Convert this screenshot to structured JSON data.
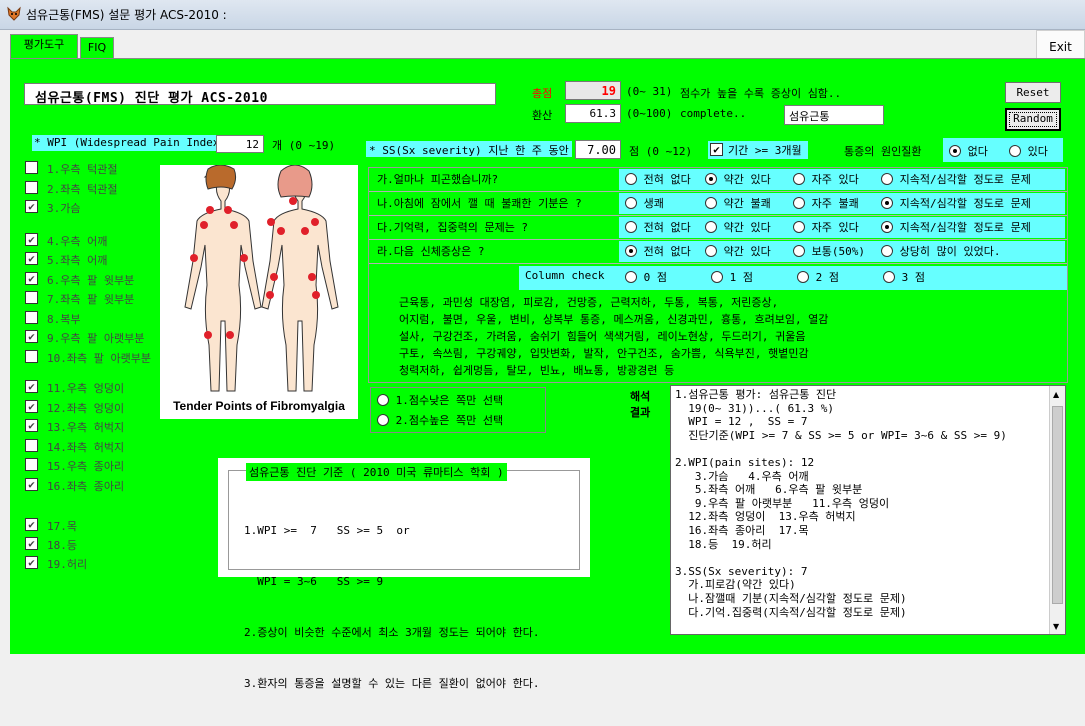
{
  "window": {
    "title": "섬유근통(FMS) 설문 평가 ACS-2010 :",
    "exit_label": "Exit"
  },
  "tabs": [
    {
      "label": "평가도구",
      "active": true
    },
    {
      "label": "FIQ",
      "active": false
    }
  ],
  "header": {
    "banner": "섬유근통(FMS) 진단 평가 ACS-2010",
    "total_label": "총점",
    "total_value": "19",
    "total_range": "(0~ 31)",
    "total_note": "점수가 높을 수록 증상이 심함..",
    "conv_label": "환산",
    "conv_value": "61.3",
    "conv_range": "(0~100)",
    "conv_note": "complete..",
    "diagnosis_value": "섬유근통",
    "reset_label": "Reset",
    "random_label": "Random"
  },
  "wpi": {
    "label": "* WPI (Widespread Pain Index)",
    "value": "12",
    "unit": "개 (0 ~19)"
  },
  "sites": [
    {
      "label": "1.우측 턱관절",
      "checked": false
    },
    {
      "label": "2.좌측 턱관절",
      "checked": false
    },
    {
      "label": "3.가슴",
      "checked": true
    },
    {
      "label": "4.우측 어깨",
      "checked": true
    },
    {
      "label": "5.좌측 어깨",
      "checked": true
    },
    {
      "label": "6.우측 팔 윗부분",
      "checked": true
    },
    {
      "label": "7.좌측 팔 윗부분",
      "checked": false
    },
    {
      "label": "8.복부",
      "checked": false
    },
    {
      "label": "9.우측 팔 아랫부분",
      "checked": true
    },
    {
      "label": "10.좌측 팔 아랫부분",
      "checked": false
    },
    {
      "label": "11.우측 엉덩이",
      "checked": true
    },
    {
      "label": "12.좌측 엉덩이",
      "checked": true
    },
    {
      "label": "13.우측 허벅지",
      "checked": true
    },
    {
      "label": "14.좌측 허벅지",
      "checked": false
    },
    {
      "label": "15.우측 종아리",
      "checked": false
    },
    {
      "label": "16.좌측 종아리",
      "checked": true
    },
    {
      "label": "17.목",
      "checked": true
    },
    {
      "label": "18.등",
      "checked": true
    },
    {
      "label": "19.허리",
      "checked": true
    }
  ],
  "figure": {
    "caption": "Tender Points of Fibromyalgia"
  },
  "ss": {
    "label": "* SS(Sx severity) 지난 한 주 동안",
    "value": "7.00",
    "unit": "점 (0 ~12)",
    "duration_label": "기간 >= 3개월",
    "duration_checked": true,
    "cause_label": "통증의 원인질환",
    "cause_options": [
      {
        "label": "없다",
        "selected": true
      },
      {
        "label": "있다",
        "selected": false
      }
    ]
  },
  "questions": [
    {
      "label": "가.얼마나 피곤했습니까?",
      "options": [
        {
          "label": "전혀 없다",
          "selected": false
        },
        {
          "label": "약간 있다",
          "selected": true
        },
        {
          "label": "자주 있다",
          "selected": false
        },
        {
          "label": "지속적/심각할 정도로 문제",
          "selected": false
        }
      ]
    },
    {
      "label": "나.아침에 잠에서 깰 때 불쾌한 기분은 ?",
      "options": [
        {
          "label": "생쾌",
          "selected": false
        },
        {
          "label": "약간 불쾌",
          "selected": false
        },
        {
          "label": "자주 불쾌",
          "selected": false
        },
        {
          "label": "지속적/심각할 정도로 문제",
          "selected": true
        }
      ]
    },
    {
      "label": "다.기억력, 집중력의 문제는 ?",
      "options": [
        {
          "label": "전혀 없다",
          "selected": false
        },
        {
          "label": "약간 있다",
          "selected": false
        },
        {
          "label": "자주 있다",
          "selected": false
        },
        {
          "label": "지속적/심각할 정도로 문제",
          "selected": true
        }
      ]
    },
    {
      "label": "라.다음 신체증상은 ?",
      "options": [
        {
          "label": "전혀 없다",
          "selected": true
        },
        {
          "label": "약간 있다",
          "selected": false
        },
        {
          "label": "보통(50%)",
          "selected": false
        },
        {
          "label": "상당히 많이 있었다.",
          "selected": false
        }
      ]
    }
  ],
  "column_check": {
    "label": "Column check",
    "options": [
      {
        "label": "0 점",
        "selected": false
      },
      {
        "label": "1 점",
        "selected": false
      },
      {
        "label": "2 점",
        "selected": false
      },
      {
        "label": "3 점",
        "selected": false
      }
    ]
  },
  "symptoms": [
    "근육통, 과민성 대장염, 피로감, 건망증, 근력저하, 두통, 복통, 저린증상,",
    "어지럼, 불면, 우울, 변비, 상복부 통증, 메스꺼움, 신경과민, 흉통, 흐려보임, 열감",
    "설사, 구강건조, 가려움, 숨쉬기 힘들어 색색거림, 레이노현상, 두드러기, 귀울음",
    "구토, 속쓰림, 구강궤양, 입맛변화, 발작, 안구건조, 숨가쁨, 식욕부진, 햇볕민감",
    "청력저하, 쉽게멍듬, 탈모, 빈뇨, 배뇨통, 방광경련 등"
  ],
  "selection": [
    {
      "label": "1.점수낮은 쪽만 선택",
      "selected": false
    },
    {
      "label": "2.점수높은 쪽만 선택",
      "selected": false
    }
  ],
  "criteria": {
    "title": "섬유근통 진단 기준 ( 2010 미국 류마티스 학회 )",
    "lines": [
      "1.WPI >=  7   SS >= 5  or",
      "  WPI = 3~6   SS >= 9",
      "2.증상이 비슷한 수준에서 최소 3개월 정도는 되어야 한다.",
      "3.환자의 통증을 설명할 수 있는 다른 질환이 없어야 한다."
    ]
  },
  "interpretation": {
    "label_line1": "해석",
    "label_line2": "결과",
    "text": "1.섬유근통 평가: 섬유근통 진단\n  19(0~ 31))...( 61.3 %)\n  WPI = 12 ,  SS = 7\n  진단기준(WPI >= 7 & SS >= 5 or WPI= 3~6 & SS >= 9)\n\n2.WPI(pain sites): 12\n   3.가슴   4.우측 어깨\n   5.좌측 어깨   6.우측 팔 윗부분\n   9.우측 팔 아랫부분   11.우측 엉덩이\n  12.좌측 엉덩이  13.우측 허벅지\n  16.좌측 종아리  17.목\n  18.등  19.허리\n\n3.SS(Sx severity): 7\n  가.피로감(약간 있다)\n  나.잠깰때 기분(지속적/심각할 정도로 문제)\n  다.기억.집중력(지속적/심각할 정도로 문제)"
  },
  "colors": {
    "panel_bg": "#00ff00",
    "highlight": "#66ffff",
    "score_red": "#ff0000"
  }
}
